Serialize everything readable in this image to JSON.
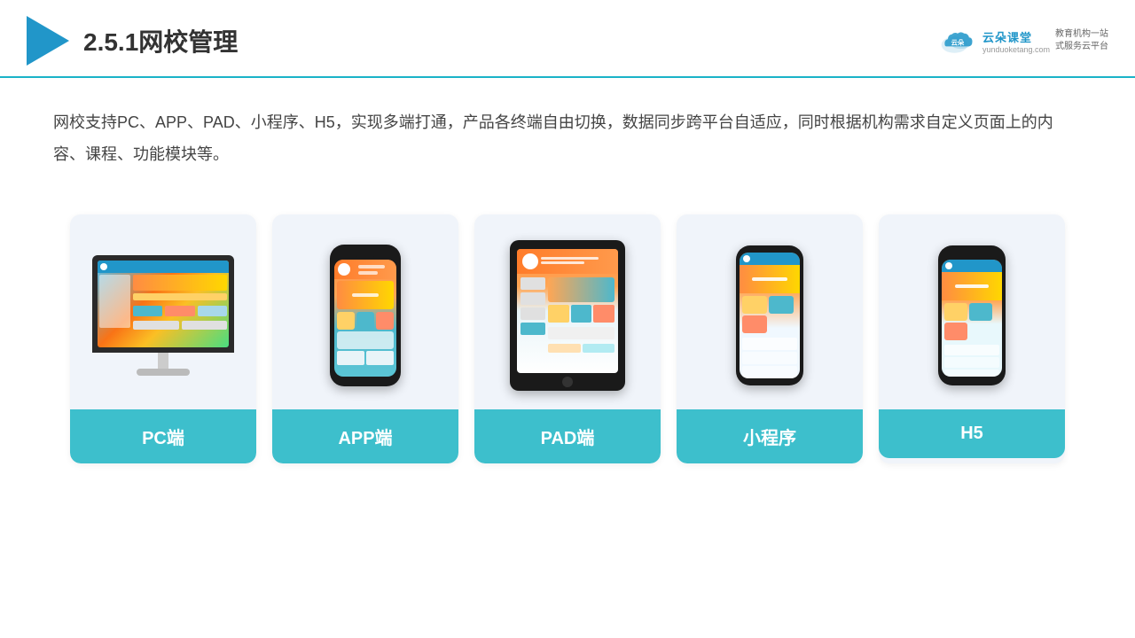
{
  "header": {
    "title": "2.5.1网校管理",
    "brand": {
      "name": "云朵课堂",
      "url": "yunduoketang.com",
      "slogan_line1": "教育机构一站",
      "slogan_line2": "式服务云平台"
    }
  },
  "description": {
    "text": "网校支持PC、APP、PAD、小程序、H5，实现多端打通，产品各终端自由切换，数据同步跨平台自适应，同时根据机构需求自定义页面上的内容、课程、功能模块等。"
  },
  "cards": [
    {
      "id": "pc",
      "label": "PC端"
    },
    {
      "id": "app",
      "label": "APP端"
    },
    {
      "id": "pad",
      "label": "PAD端"
    },
    {
      "id": "miniapp",
      "label": "小程序"
    },
    {
      "id": "h5",
      "label": "H5"
    }
  ]
}
